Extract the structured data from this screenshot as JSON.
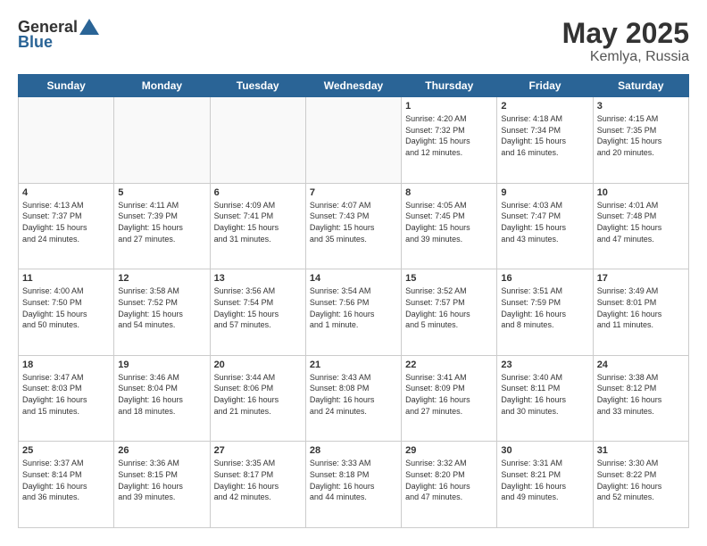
{
  "header": {
    "logo_general": "General",
    "logo_blue": "Blue",
    "month": "May 2025",
    "location": "Kemlya, Russia"
  },
  "weekdays": [
    "Sunday",
    "Monday",
    "Tuesday",
    "Wednesday",
    "Thursday",
    "Friday",
    "Saturday"
  ],
  "weeks": [
    [
      {
        "day": "",
        "info": ""
      },
      {
        "day": "",
        "info": ""
      },
      {
        "day": "",
        "info": ""
      },
      {
        "day": "",
        "info": ""
      },
      {
        "day": "1",
        "info": "Sunrise: 4:20 AM\nSunset: 7:32 PM\nDaylight: 15 hours\nand 12 minutes."
      },
      {
        "day": "2",
        "info": "Sunrise: 4:18 AM\nSunset: 7:34 PM\nDaylight: 15 hours\nand 16 minutes."
      },
      {
        "day": "3",
        "info": "Sunrise: 4:15 AM\nSunset: 7:35 PM\nDaylight: 15 hours\nand 20 minutes."
      }
    ],
    [
      {
        "day": "4",
        "info": "Sunrise: 4:13 AM\nSunset: 7:37 PM\nDaylight: 15 hours\nand 24 minutes."
      },
      {
        "day": "5",
        "info": "Sunrise: 4:11 AM\nSunset: 7:39 PM\nDaylight: 15 hours\nand 27 minutes."
      },
      {
        "day": "6",
        "info": "Sunrise: 4:09 AM\nSunset: 7:41 PM\nDaylight: 15 hours\nand 31 minutes."
      },
      {
        "day": "7",
        "info": "Sunrise: 4:07 AM\nSunset: 7:43 PM\nDaylight: 15 hours\nand 35 minutes."
      },
      {
        "day": "8",
        "info": "Sunrise: 4:05 AM\nSunset: 7:45 PM\nDaylight: 15 hours\nand 39 minutes."
      },
      {
        "day": "9",
        "info": "Sunrise: 4:03 AM\nSunset: 7:47 PM\nDaylight: 15 hours\nand 43 minutes."
      },
      {
        "day": "10",
        "info": "Sunrise: 4:01 AM\nSunset: 7:48 PM\nDaylight: 15 hours\nand 47 minutes."
      }
    ],
    [
      {
        "day": "11",
        "info": "Sunrise: 4:00 AM\nSunset: 7:50 PM\nDaylight: 15 hours\nand 50 minutes."
      },
      {
        "day": "12",
        "info": "Sunrise: 3:58 AM\nSunset: 7:52 PM\nDaylight: 15 hours\nand 54 minutes."
      },
      {
        "day": "13",
        "info": "Sunrise: 3:56 AM\nSunset: 7:54 PM\nDaylight: 15 hours\nand 57 minutes."
      },
      {
        "day": "14",
        "info": "Sunrise: 3:54 AM\nSunset: 7:56 PM\nDaylight: 16 hours\nand 1 minute."
      },
      {
        "day": "15",
        "info": "Sunrise: 3:52 AM\nSunset: 7:57 PM\nDaylight: 16 hours\nand 5 minutes."
      },
      {
        "day": "16",
        "info": "Sunrise: 3:51 AM\nSunset: 7:59 PM\nDaylight: 16 hours\nand 8 minutes."
      },
      {
        "day": "17",
        "info": "Sunrise: 3:49 AM\nSunset: 8:01 PM\nDaylight: 16 hours\nand 11 minutes."
      }
    ],
    [
      {
        "day": "18",
        "info": "Sunrise: 3:47 AM\nSunset: 8:03 PM\nDaylight: 16 hours\nand 15 minutes."
      },
      {
        "day": "19",
        "info": "Sunrise: 3:46 AM\nSunset: 8:04 PM\nDaylight: 16 hours\nand 18 minutes."
      },
      {
        "day": "20",
        "info": "Sunrise: 3:44 AM\nSunset: 8:06 PM\nDaylight: 16 hours\nand 21 minutes."
      },
      {
        "day": "21",
        "info": "Sunrise: 3:43 AM\nSunset: 8:08 PM\nDaylight: 16 hours\nand 24 minutes."
      },
      {
        "day": "22",
        "info": "Sunrise: 3:41 AM\nSunset: 8:09 PM\nDaylight: 16 hours\nand 27 minutes."
      },
      {
        "day": "23",
        "info": "Sunrise: 3:40 AM\nSunset: 8:11 PM\nDaylight: 16 hours\nand 30 minutes."
      },
      {
        "day": "24",
        "info": "Sunrise: 3:38 AM\nSunset: 8:12 PM\nDaylight: 16 hours\nand 33 minutes."
      }
    ],
    [
      {
        "day": "25",
        "info": "Sunrise: 3:37 AM\nSunset: 8:14 PM\nDaylight: 16 hours\nand 36 minutes."
      },
      {
        "day": "26",
        "info": "Sunrise: 3:36 AM\nSunset: 8:15 PM\nDaylight: 16 hours\nand 39 minutes."
      },
      {
        "day": "27",
        "info": "Sunrise: 3:35 AM\nSunset: 8:17 PM\nDaylight: 16 hours\nand 42 minutes."
      },
      {
        "day": "28",
        "info": "Sunrise: 3:33 AM\nSunset: 8:18 PM\nDaylight: 16 hours\nand 44 minutes."
      },
      {
        "day": "29",
        "info": "Sunrise: 3:32 AM\nSunset: 8:20 PM\nDaylight: 16 hours\nand 47 minutes."
      },
      {
        "day": "30",
        "info": "Sunrise: 3:31 AM\nSunset: 8:21 PM\nDaylight: 16 hours\nand 49 minutes."
      },
      {
        "day": "31",
        "info": "Sunrise: 3:30 AM\nSunset: 8:22 PM\nDaylight: 16 hours\nand 52 minutes."
      }
    ]
  ]
}
